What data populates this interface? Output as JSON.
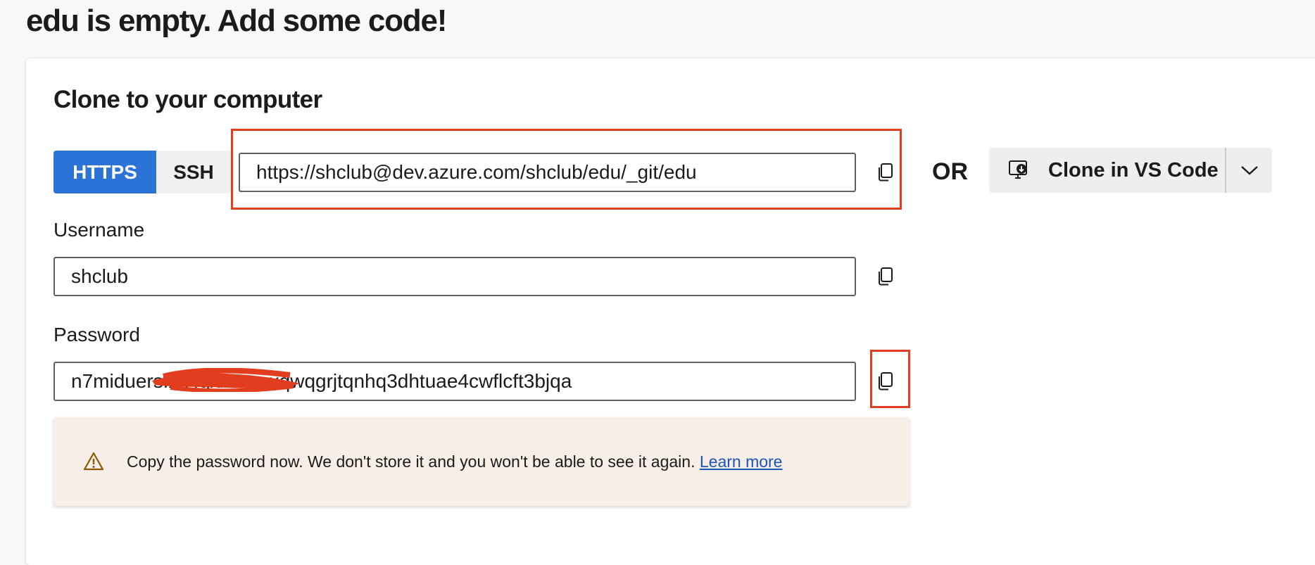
{
  "page_title": "edu is empty. Add some code!",
  "clone": {
    "title": "Clone to your computer",
    "protocols": [
      {
        "label": "HTTPS",
        "selected": true
      },
      {
        "label": "SSH",
        "selected": false
      }
    ],
    "url": "https://shclub@dev.azure.com/shclub/edu/_git/edu",
    "or_label": "OR",
    "vscode_button": {
      "label": "Clone in VS Code",
      "icon": "vscode-clone-icon",
      "dropdown_icon": "chevron-down-icon"
    },
    "copy_icon": "copy-icon"
  },
  "credentials": {
    "username_label": "Username",
    "username_value": "shclub",
    "password_label": "Password",
    "password_value": "n7miduersfxk4gxxxxxxxqwqgrjtqnhq3dhtuae4cwflcft3bjqa"
  },
  "warning": {
    "icon": "warning-icon",
    "text": "Copy the password now. We don't store it and you won't be able to see it again.",
    "link": "Learn more"
  },
  "colors": {
    "accent": "#2b73d6",
    "highlight": "#e23d1f",
    "warning_bg": "#f7eee8",
    "link": "#1a56b8"
  }
}
